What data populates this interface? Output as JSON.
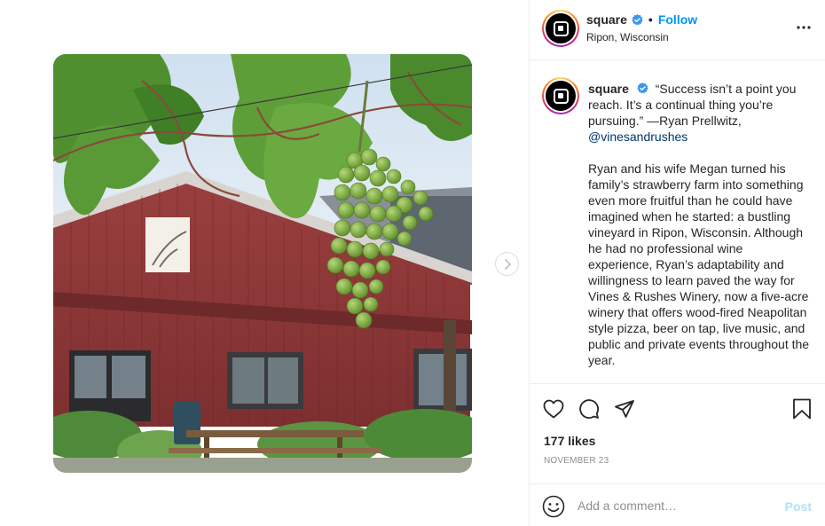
{
  "header": {
    "username": "square",
    "separator": "•",
    "follow_label": "Follow",
    "location": "Ripon, Wisconsin",
    "more_icon": "more-dots-icon"
  },
  "caption": {
    "username": "square",
    "quote": "“Success isn’t a point you reach. It’s a continual thing you’re pursuing.” —Ryan Prellwitz,",
    "mention": "@vinesandrushes",
    "body": "Ryan and his wife Megan turned his family’s strawberry farm into something even more fruitful than he could have imagined when he started: a bustling vineyard in Ripon, Wisconsin. Although he had no professional wine experience, Ryan’s adaptability and willingness to learn paved the way for Vines & Rushes Winery, now a five-acre winery that offers wood-fired Neapolitan style pizza, beer on tap, live music, and public and private events throughout the year."
  },
  "stats": {
    "likes": "177 likes",
    "date": "NOVEMBER 23"
  },
  "comment": {
    "placeholder": "Add a comment…",
    "post_label": "Post"
  },
  "colors": {
    "accent": "#0095f6",
    "verified": "#3897f0",
    "mention": "#00376b",
    "muted": "#8e8e8e",
    "post_disabled": "#b2dffc"
  }
}
